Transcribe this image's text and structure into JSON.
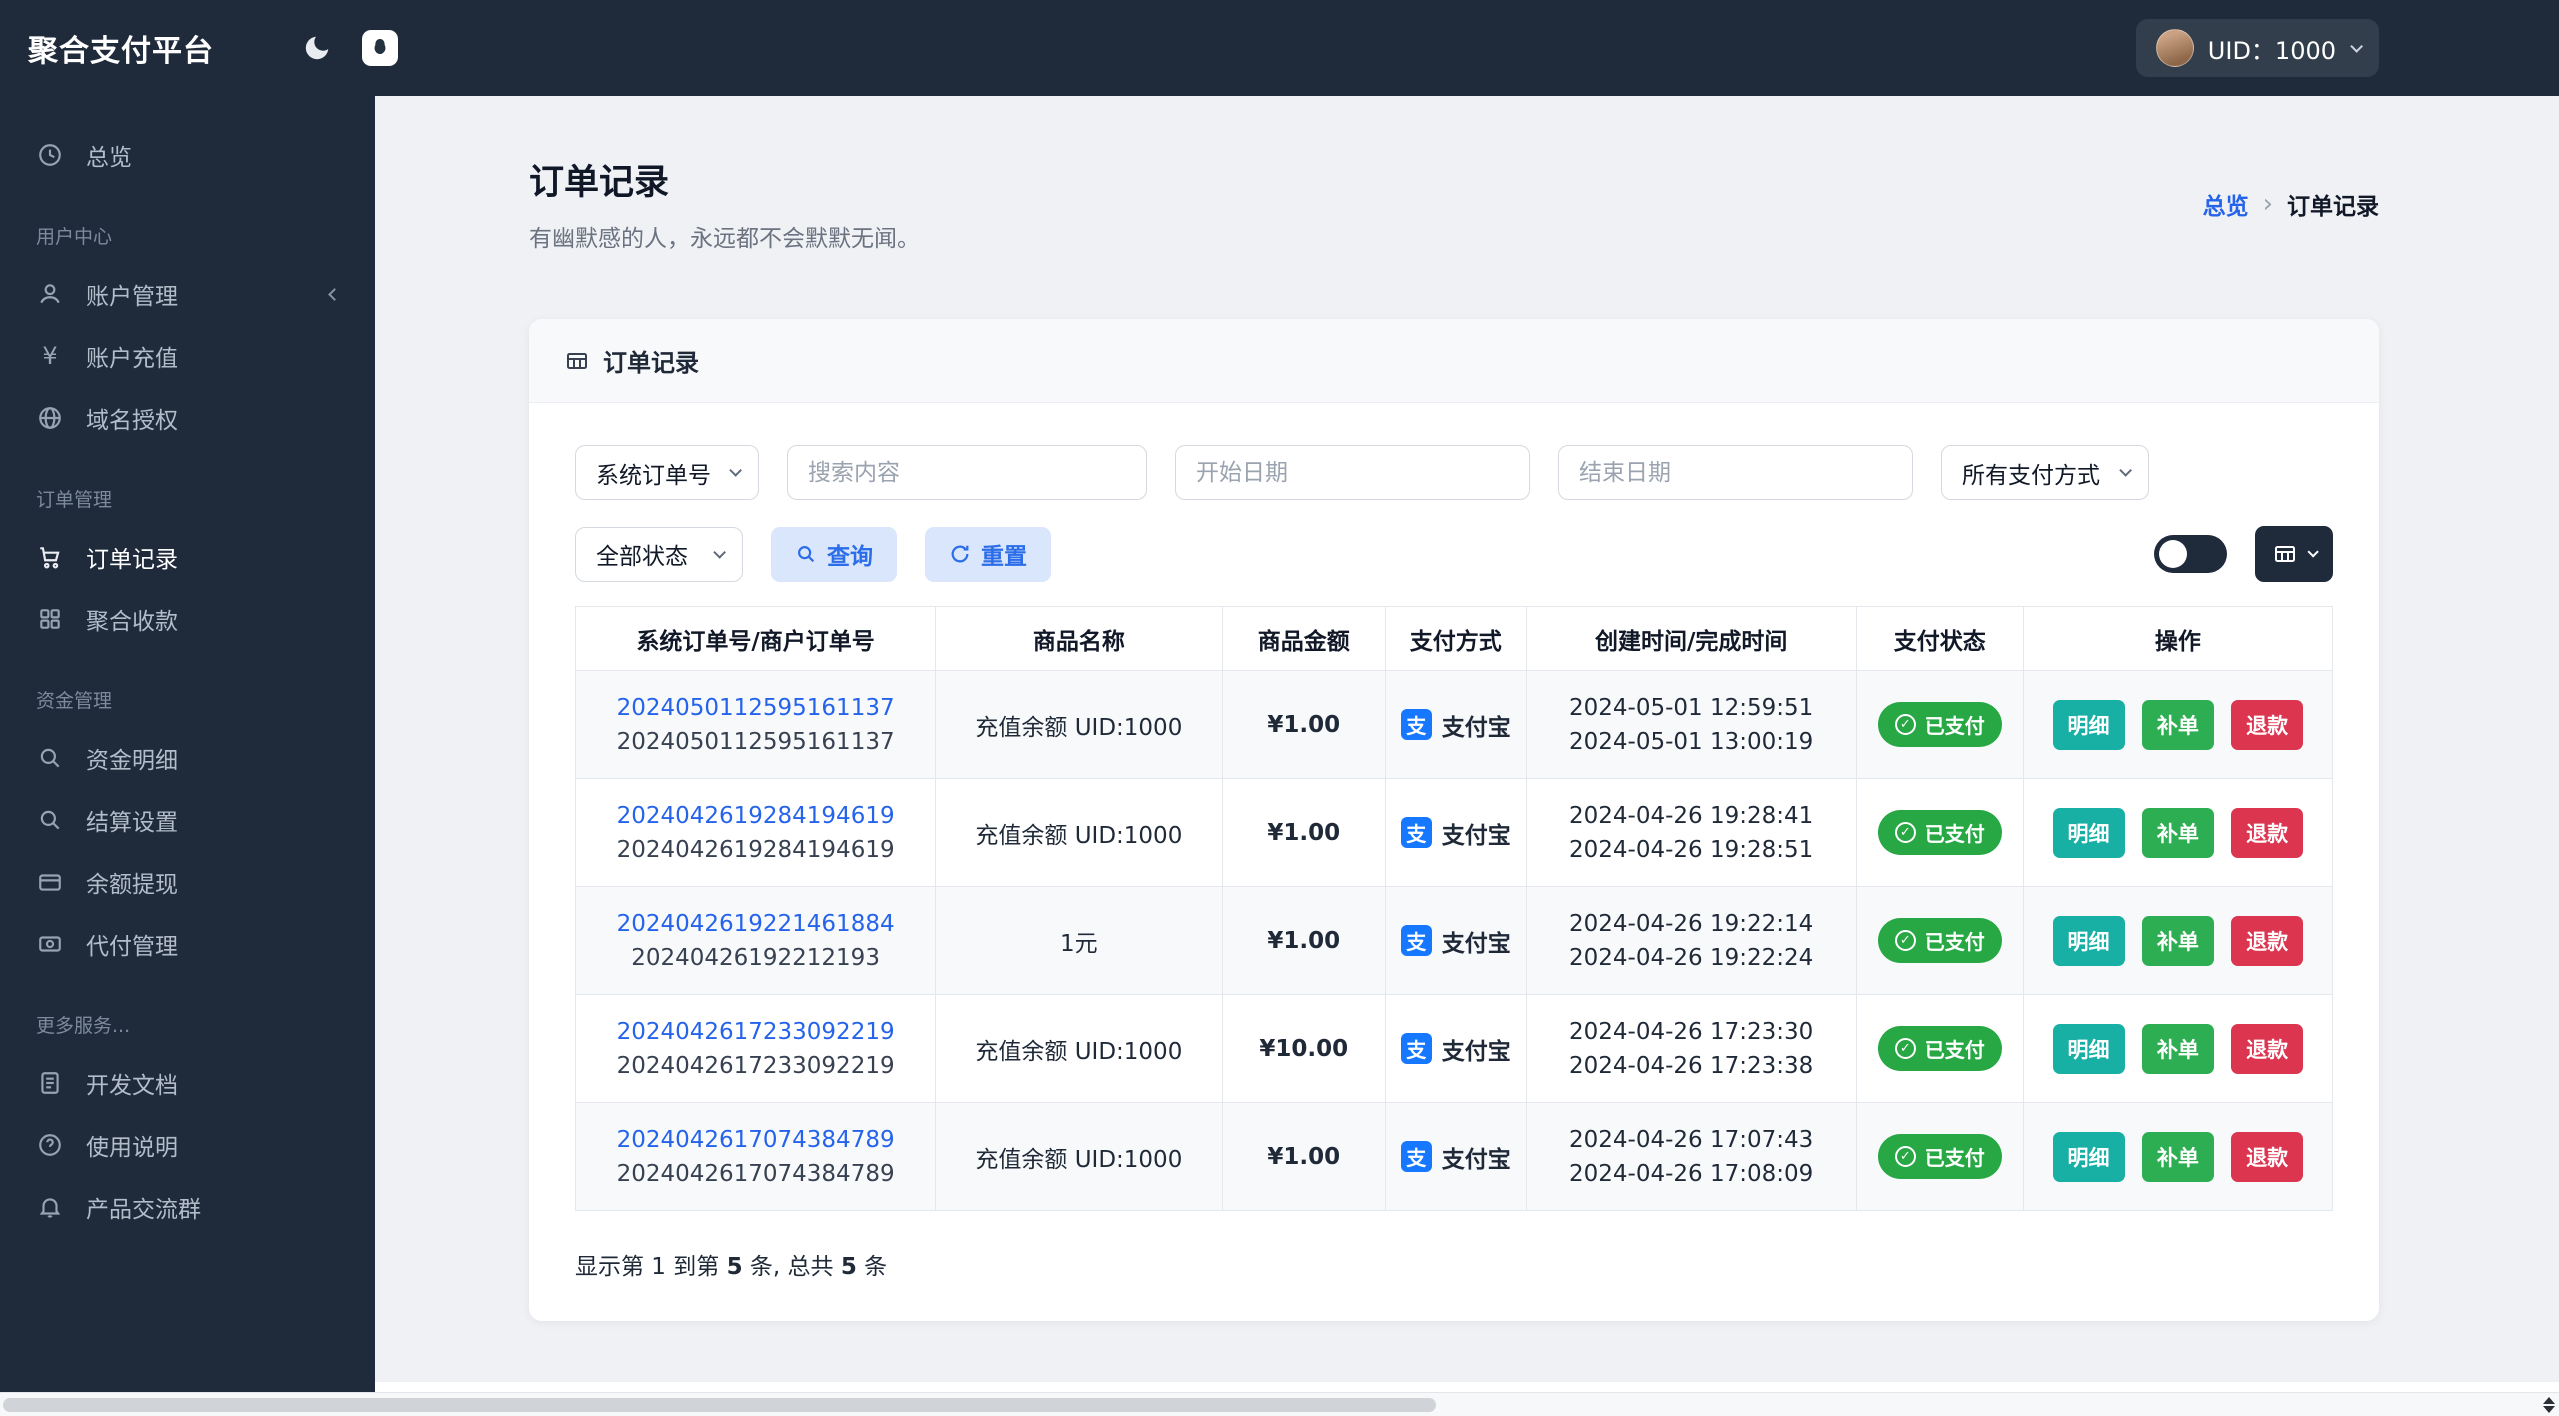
{
  "icons": {
    "check": "✓",
    "breadcrumb_sep": "›",
    "alipay_glyph": "支",
    "yen_glyph": "¥"
  },
  "topbar": {
    "brand": "聚合支付平台",
    "uid": "UID：1000"
  },
  "sidebar": {
    "overview": "总览",
    "sections": [
      {
        "heading": "用户中心",
        "items": [
          "账户管理",
          "账户充值",
          "域名授权"
        ]
      },
      {
        "heading": "订单管理",
        "items": [
          "订单记录",
          "聚合收款"
        ]
      },
      {
        "heading": "资金管理",
        "items": [
          "资金明细",
          "结算设置",
          "余额提现",
          "代付管理"
        ]
      },
      {
        "heading": "更多服务...",
        "items": [
          "开发文档",
          "使用说明",
          "产品交流群"
        ]
      }
    ]
  },
  "page": {
    "title": "订单记录",
    "subtitle": "有幽默感的人，永远都不会默默无闻。",
    "breadcrumb": {
      "home": "总览",
      "current": "订单记录"
    }
  },
  "card": {
    "title": "订单记录"
  },
  "filters": {
    "order_type": "系统订单号",
    "search_placeholder": "搜索内容",
    "start_date_placeholder": "开始日期",
    "end_date_placeholder": "结束日期",
    "pay_method": "所有支付方式",
    "status": "全部状态",
    "query": "查询",
    "reset": "重置"
  },
  "table": {
    "headers": [
      "系统订单号/商户订单号",
      "商品名称",
      "商品金额",
      "支付方式",
      "创建时间/完成时间",
      "支付状态",
      "操作"
    ],
    "action_labels": {
      "detail": "明细",
      "reissue": "补单",
      "refund": "退款"
    },
    "rows": [
      {
        "sys_no": "2024050112595161137",
        "mch_no": "2024050112595161137",
        "product": "充值余额 UID:1000",
        "amount": "¥1.00",
        "pay": "支付宝",
        "created": "2024-05-01 12:59:51",
        "finished": "2024-05-01 13:00:19",
        "status": "已支付"
      },
      {
        "sys_no": "2024042619284194619",
        "mch_no": "2024042619284194619",
        "product": "充值余额 UID:1000",
        "amount": "¥1.00",
        "pay": "支付宝",
        "created": "2024-04-26 19:28:41",
        "finished": "2024-04-26 19:28:51",
        "status": "已支付"
      },
      {
        "sys_no": "2024042619221461884",
        "mch_no": "20240426192212193",
        "product": "1元",
        "amount": "¥1.00",
        "pay": "支付宝",
        "created": "2024-04-26 19:22:14",
        "finished": "2024-04-26 19:22:24",
        "status": "已支付"
      },
      {
        "sys_no": "2024042617233092219",
        "mch_no": "2024042617233092219",
        "product": "充值余额 UID:1000",
        "amount": "¥10.00",
        "pay": "支付宝",
        "created": "2024-04-26 17:23:30",
        "finished": "2024-04-26 17:23:38",
        "status": "已支付"
      },
      {
        "sys_no": "2024042617074384789",
        "mch_no": "2024042617074384789",
        "product": "充值余额 UID:1000",
        "amount": "¥1.00",
        "pay": "支付宝",
        "created": "2024-04-26 17:07:43",
        "finished": "2024-04-26 17:08:09",
        "status": "已支付"
      }
    ]
  },
  "summary": {
    "p1": "显示第 1 到第 ",
    "n1": "5",
    "p2": " 条, 总共 ",
    "n2": "5",
    "p3": " 条"
  }
}
